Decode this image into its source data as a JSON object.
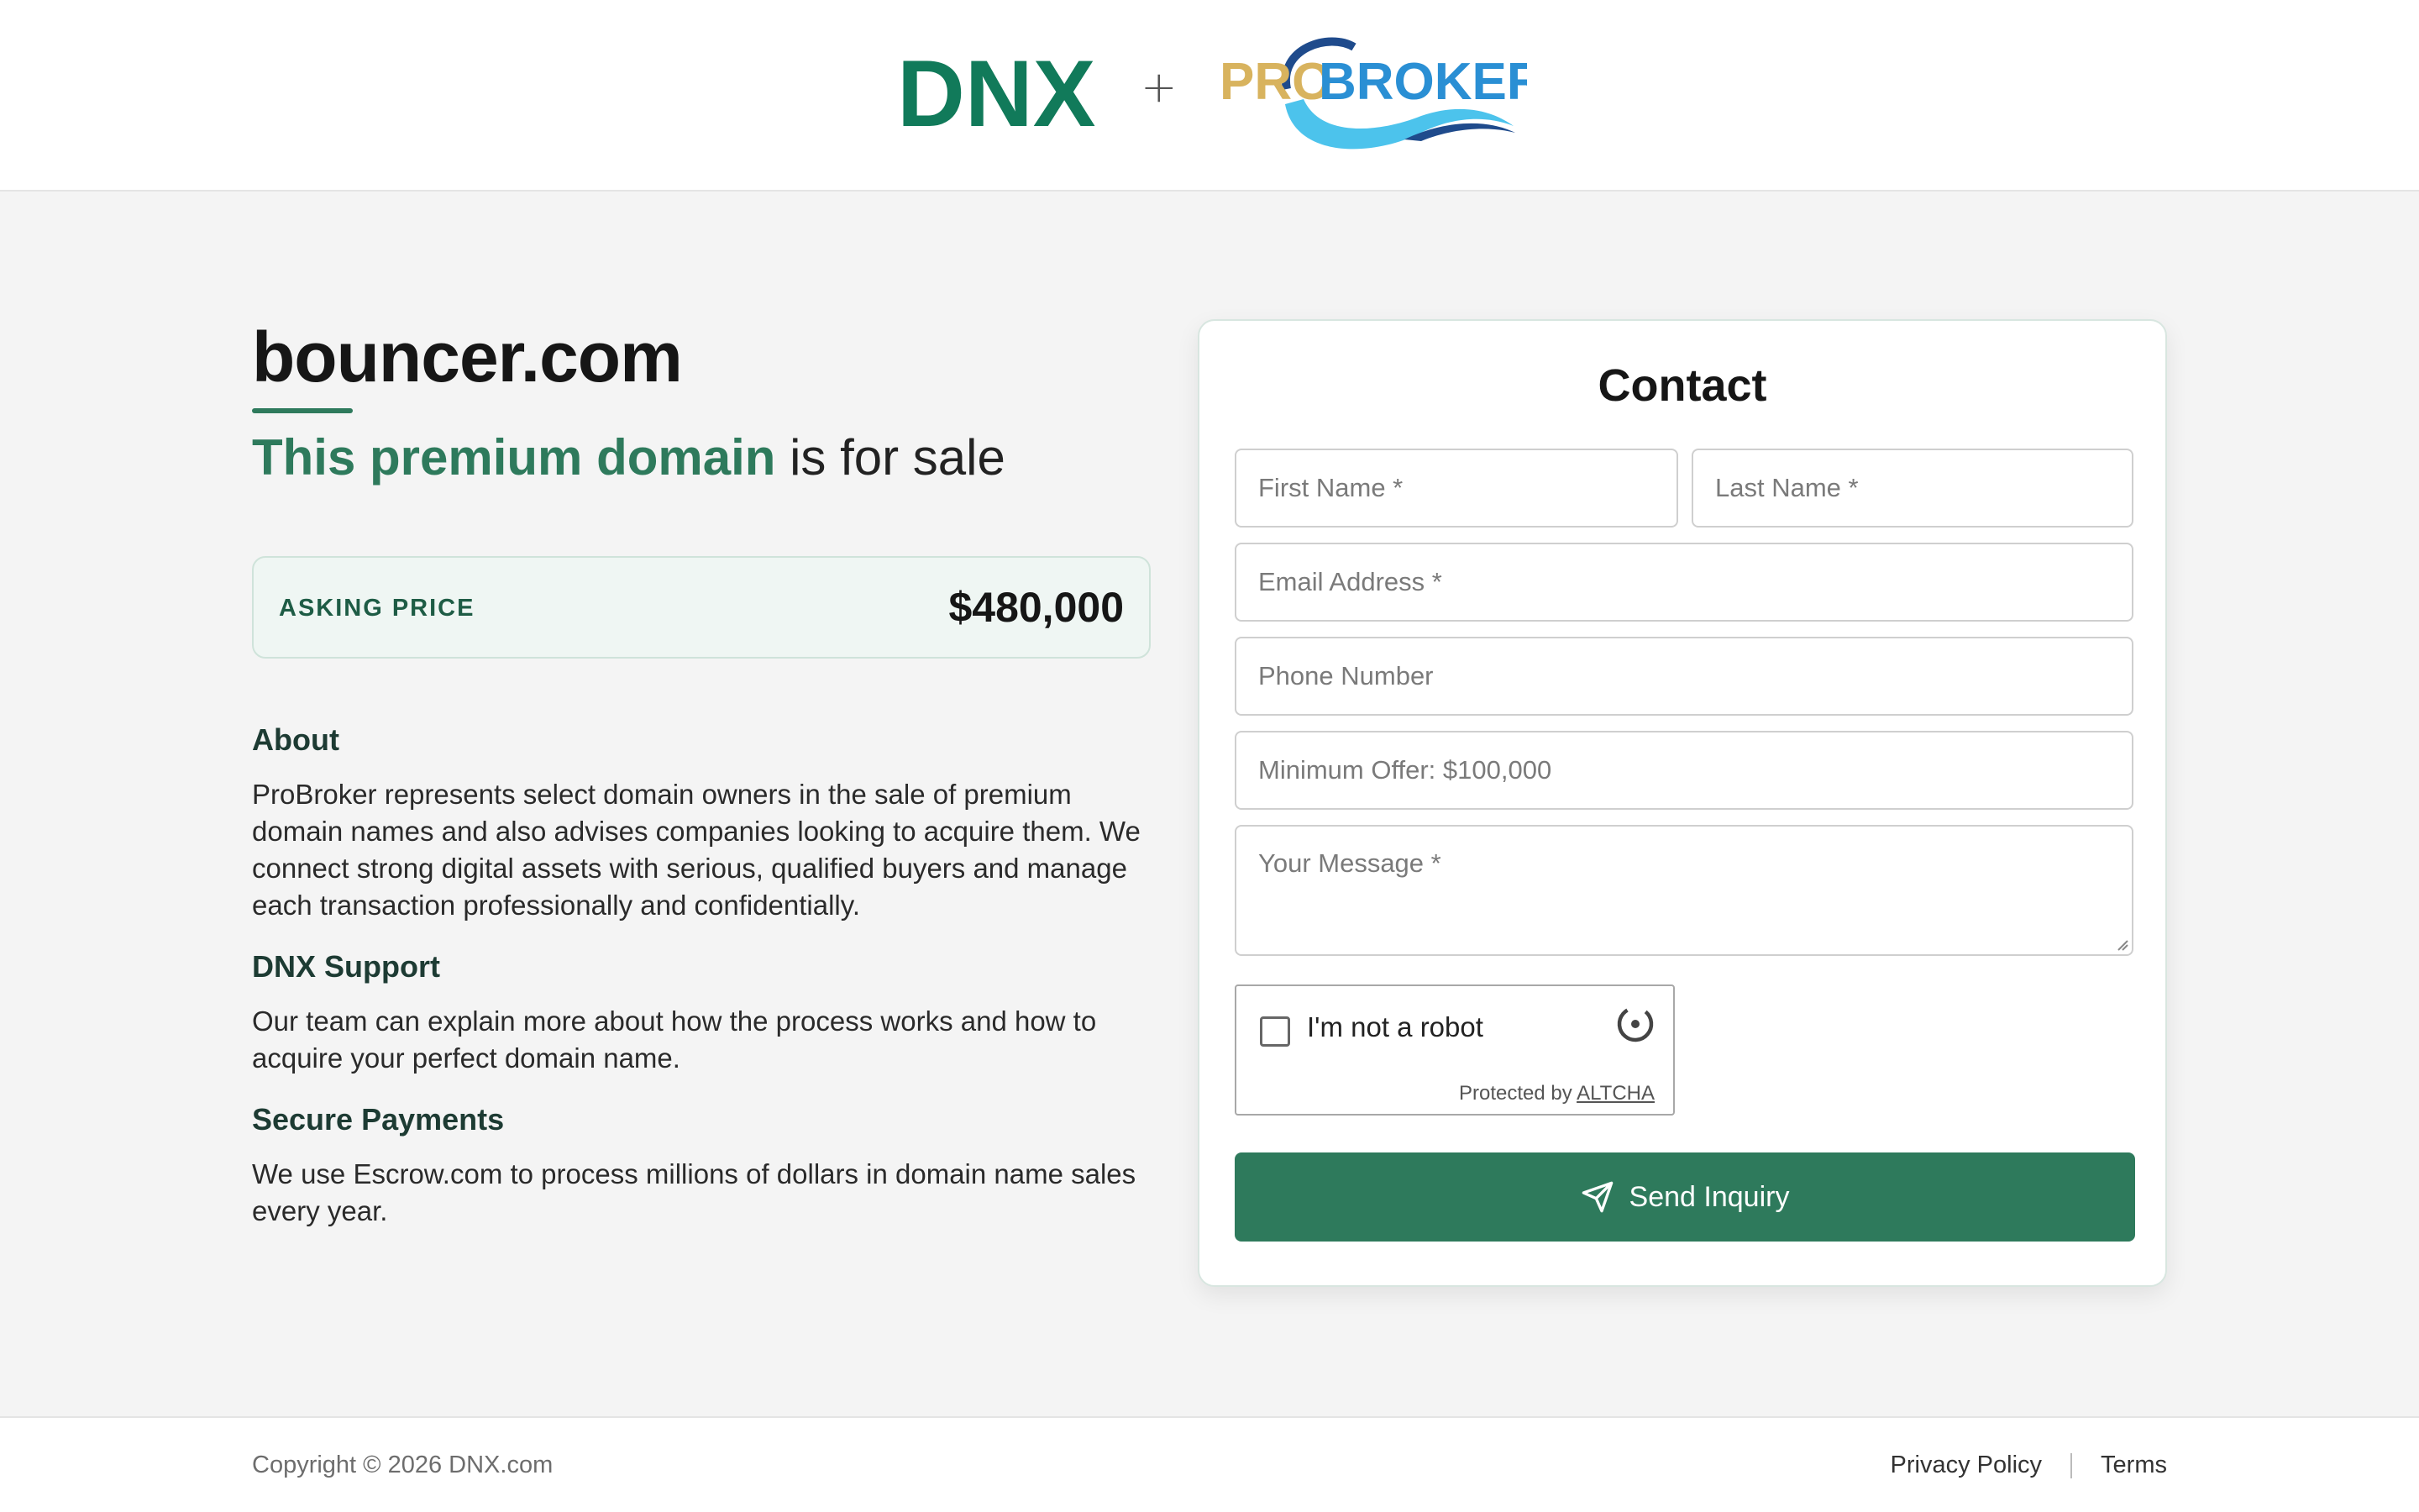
{
  "header": {
    "brand_left": "DNX",
    "plus": "+",
    "brand_right_part1": "PRO",
    "brand_right_part2": "BROKER"
  },
  "domain": {
    "name": "bouncer.com",
    "tagline_highlight": "This premium domain",
    "tagline_rest": " is for sale"
  },
  "price": {
    "label": "ASKING PRICE",
    "value": "$480,000"
  },
  "info": {
    "about_title": "About",
    "about_text": "ProBroker represents select domain owners in the sale of premium domain names and also advises companies looking to acquire them. We connect strong digital assets with serious, qualified buyers and manage each transaction professionally and confidentially.",
    "support_title": "DNX Support",
    "support_text": "Our team can explain more about how the process works and how to acquire your perfect domain name.",
    "payments_title": "Secure Payments",
    "payments_text": "We use Escrow.com to process millions of dollars in domain name sales every year."
  },
  "contact": {
    "title": "Contact",
    "first_name_placeholder": "First Name *",
    "last_name_placeholder": "Last Name *",
    "email_placeholder": "Email Address *",
    "phone_placeholder": "Phone Number",
    "offer_placeholder": "Minimum Offer: $100,000",
    "message_placeholder": "Your Message *",
    "captcha_label": "I'm not a robot",
    "captcha_protected": "Protected by",
    "captcha_brand": "ALTCHA",
    "send_label": "Send Inquiry"
  },
  "footer": {
    "copyright": "Copyright © 2026 DNX.com",
    "privacy": "Privacy Policy",
    "terms": "Terms"
  },
  "colors": {
    "accent": "#2e7a5c",
    "dnx_green": "#117a5a",
    "pro_gold": "#d8b35e",
    "pro_blue": "#2a8fd4",
    "wave_light": "#4cc3ec",
    "wave_dark": "#1f4b8c"
  }
}
